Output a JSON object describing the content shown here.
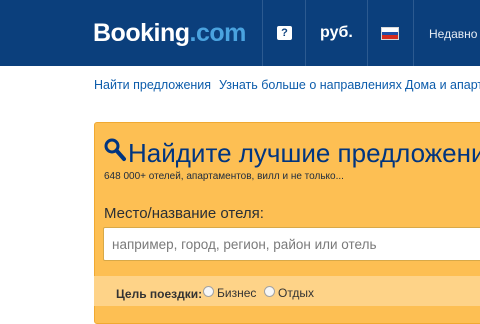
{
  "header": {
    "logo_main": "Booking",
    "logo_suffix": ".com",
    "help_icon": "question-icon",
    "currency": "руб.",
    "language_flag_icon": "russian-flag-icon",
    "flag_colors": [
      "#ffffff",
      "#1f4fa8",
      "#d52b1e"
    ],
    "recently_viewed": "Недавно в"
  },
  "subnav": {
    "items": [
      {
        "label": "Найти предложения"
      },
      {
        "label": "Узнать больше о направлениях"
      },
      {
        "label": "Дома и апарта"
      }
    ]
  },
  "search_panel": {
    "icon": "search-icon",
    "title": "Найдите лучшие предложения",
    "subtitle": "648 000+ отелей, апартаментов, вилл и не только...",
    "destination_label": "Место/название отеля:",
    "destination_placeholder": "например, город, регион, район или отель",
    "destination_value": "",
    "trip_purpose_label": "Цель поездки:",
    "trip_purpose_options": [
      "Бизнес",
      "Отдых"
    ]
  },
  "colors": {
    "header_bg": "#0b3f7c",
    "brand_blue": "#003580",
    "panel_bg": "#fdbf53",
    "link": "#0c5cab"
  }
}
